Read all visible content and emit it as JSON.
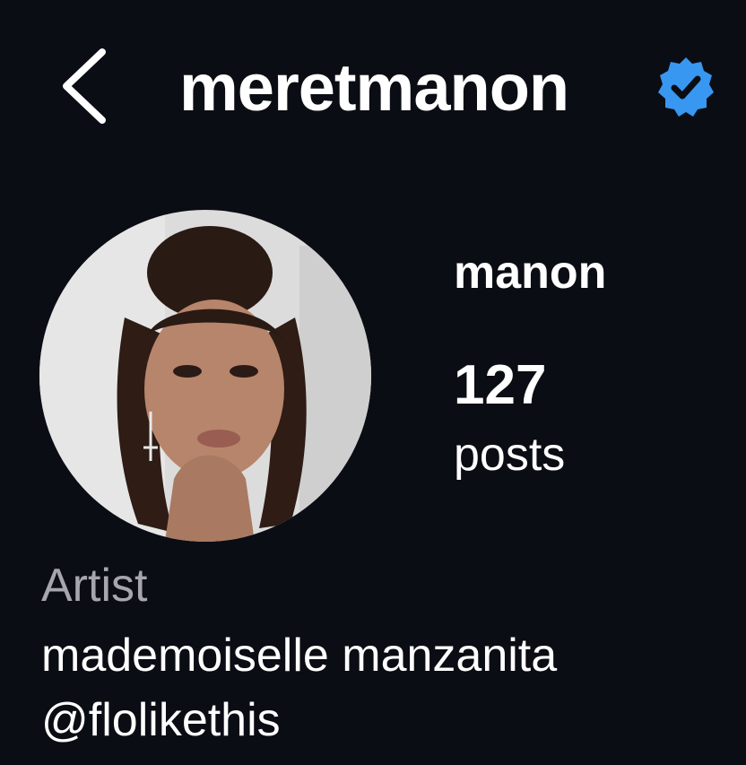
{
  "header": {
    "username": "meretmanon",
    "back_icon": "chevron-left-icon",
    "verified_icon": "verified-badge-icon",
    "verified_color": "#3897f0"
  },
  "profile": {
    "display_name": "manon",
    "posts_count": "127",
    "posts_label": "posts",
    "category": "Artist",
    "bio_line": "mademoiselle manzanita",
    "bio_mention": "@flolikethis"
  },
  "colors": {
    "background": "#0b0d14",
    "text": "#ffffff",
    "muted": "#a6a7ad"
  }
}
